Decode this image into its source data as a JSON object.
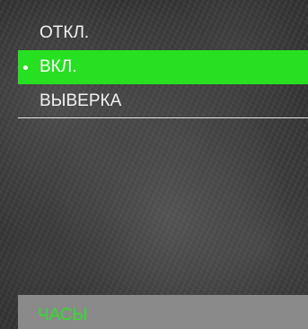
{
  "menu": {
    "items": [
      {
        "label": "ОТКЛ.",
        "selected": false
      },
      {
        "label": "ВКЛ.",
        "selected": true
      },
      {
        "label": "ВЫВЕРКА",
        "selected": false
      }
    ]
  },
  "footer": {
    "title": "ЧАСЫ"
  },
  "colors": {
    "selection": "#27e021",
    "footer_background": "#8a8a8a",
    "footer_text": "#2fe02a",
    "text": "#f2f2f2"
  },
  "icons": {
    "selected_marker": "bullet-icon"
  }
}
